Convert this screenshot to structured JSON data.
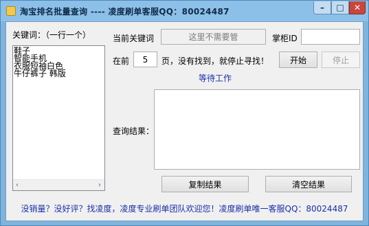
{
  "window": {
    "title": "淘宝排名批量查询 ---- 凌度刷单客服QQ：80024487",
    "minimize_glyph": "–",
    "maximize_glyph": "□",
    "close_glyph": "✕"
  },
  "keywords": {
    "label": "关键词：（一行一个）",
    "items": [
      "鞋子",
      "智能手机",
      "衣服短袖白色",
      "牛仔裤子 韩版"
    ],
    "scroll_left": "‹",
    "scroll_right": "›"
  },
  "current_keyword": {
    "label": "当前关键词",
    "value": "这里不需要管"
  },
  "shop_id": {
    "label": "掌柜ID",
    "value": ""
  },
  "pages": {
    "prefix": "在前",
    "value": "5",
    "suffix": "页，没有找到，就停止寻找！"
  },
  "buttons": {
    "start": "开始",
    "stop": "停止",
    "copy": "复制结果",
    "clear": "清空结果"
  },
  "status_text": "等待工作",
  "results": {
    "label": "查询结果：",
    "value": ""
  },
  "footer_text": "没销量？没好评？找凌度，凌度专业刷单团队欢迎您！凌度刷单唯一客服QQ：80024487"
}
